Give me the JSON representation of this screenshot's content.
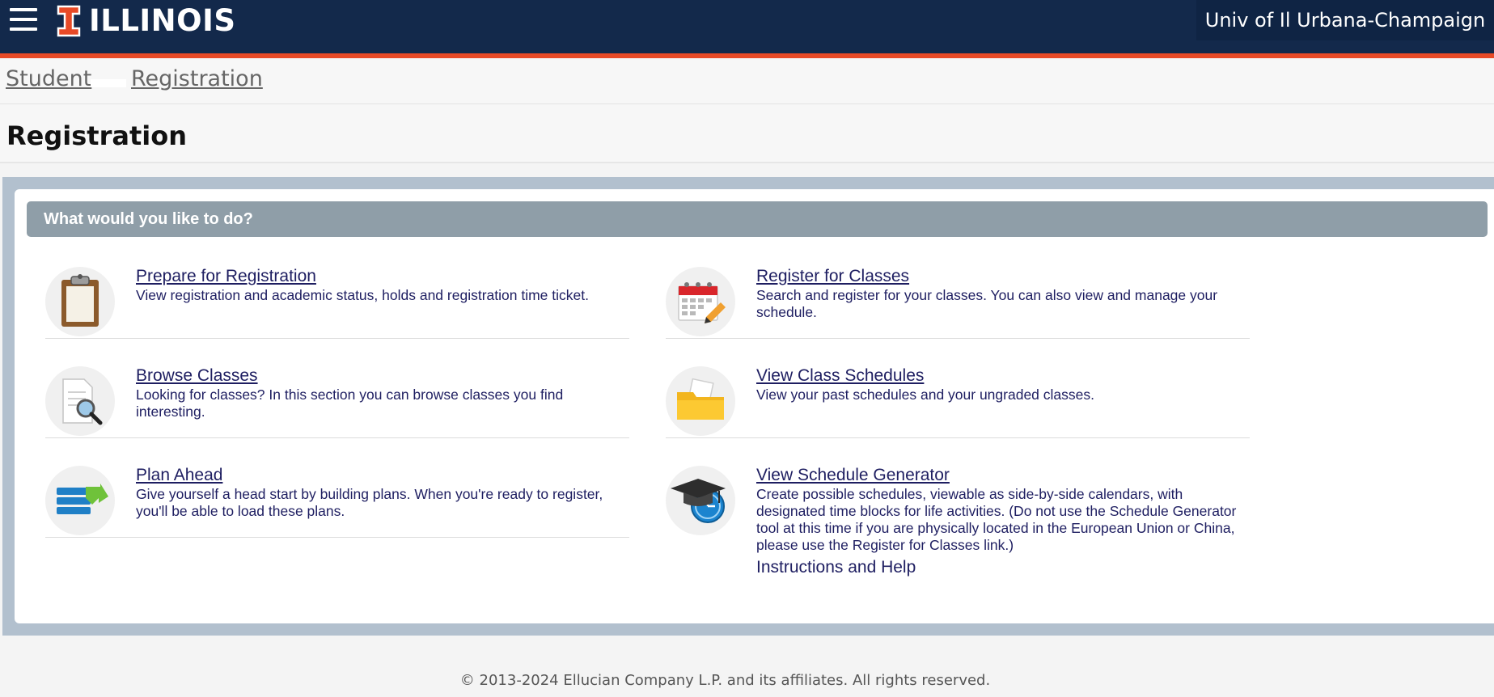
{
  "header": {
    "logo_text": "ILLINOIS",
    "institution": "Univ of Il Urbana-Champaign"
  },
  "breadcrumb": [
    "Student",
    "Registration"
  ],
  "page_title": "Registration",
  "card": {
    "heading": "What would you like to do?",
    "items": [
      {
        "title": "Prepare for Registration",
        "desc": "View registration and academic status, holds and registration time ticket.",
        "icon": "clipboard-icon"
      },
      {
        "title": "Register for Classes",
        "desc": "Search and register for your classes. You can also view and manage your schedule.",
        "icon": "calendar-pencil-icon"
      },
      {
        "title": "Browse Classes",
        "desc": "Looking for classes? In this section you can browse classes you find interesting.",
        "icon": "document-search-icon"
      },
      {
        "title": "View Class Schedules",
        "desc": "View your past schedules and your ungraded classes.",
        "icon": "folder-icon"
      },
      {
        "title": "Plan Ahead",
        "desc": "Give yourself a head start by building plans. When you're ready to register, you'll be able to load these plans.",
        "icon": "list-arrow-icon"
      },
      {
        "title": "View Schedule Generator",
        "desc": "Create possible schedules, viewable as side-by-side calendars, with designated time blocks for life activities. (Do not use the Schedule Generator tool at this time if you are physically located in the European Union or China, please use the Register for Classes link.)",
        "icon": "graduation-cap-clock-icon"
      }
    ],
    "help_link": "Instructions and Help"
  },
  "footer": {
    "copyright": "© 2013-2024 Ellucian Company L.P. and its affiliates. All rights reserved."
  },
  "colors": {
    "header_bg": "#13294b",
    "accent_orange": "#e84a27",
    "link": "#1e1e61",
    "card_header": "#8f9ea8",
    "frame": "#b2c0ce"
  }
}
